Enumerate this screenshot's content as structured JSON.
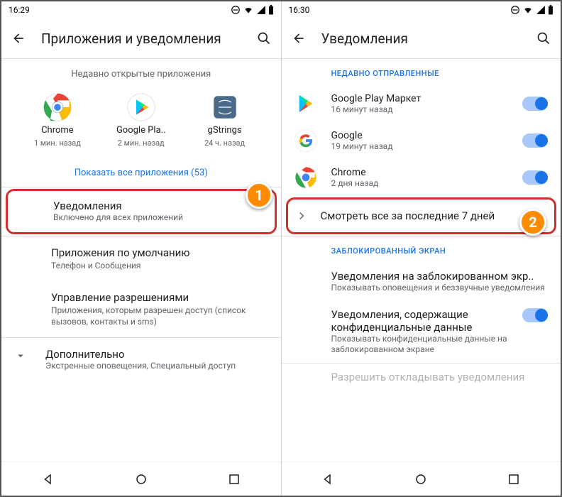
{
  "left": {
    "status_time": "16:29",
    "header_title": "Приложения и уведомления",
    "recent_apps_label": "Недавно открытые приложения",
    "apps": [
      {
        "name": "Chrome",
        "time": "1 мин. назад"
      },
      {
        "name": "Google Pla..",
        "time": "2 мин. назад"
      },
      {
        "name": "gStrings",
        "time": "24 ч. назад"
      }
    ],
    "show_all": "Показать все приложения (53)",
    "notifications": {
      "title": "Уведомления",
      "sub": "Включено для всех приложений"
    },
    "default_apps": {
      "title": "Приложения по умолчанию",
      "sub": "Телефон и Сообщения"
    },
    "permissions": {
      "title": "Управление разрешениями",
      "sub": "Приложения, которым разрешен доступ (список вызовов, контакты и sms)"
    },
    "advanced": {
      "title": "Дополнительно",
      "sub": "Экстренные оповещения, Специальный доступ"
    }
  },
  "right": {
    "status_time": "16:30",
    "header_title": "Уведомления",
    "recent_sent": "НЕДАВНО ОТПРАВЛЕННЫЕ",
    "notif_items": [
      {
        "name": "Google Play Маркет",
        "time": "16 минут назад"
      },
      {
        "name": "Google",
        "time": "19 минут назад"
      },
      {
        "name": "Chrome",
        "time": "2 дня назад"
      }
    ],
    "see_all": "Смотреть все за последние 7 дней",
    "lock_section": "ЗАБЛОКИРОВАННЫЙ ЭКРАН",
    "lock1": {
      "title": "Уведомления на заблокированном экр..",
      "sub": "Показывать оповещения и беззвучные уведомления"
    },
    "lock2": {
      "title": "Уведомления, содержащие конфиденциальные данные",
      "sub": "Показывать конфиденциальные данные на заблокированном экране"
    },
    "lock3": {
      "title": "Разрешить откладывать уведомления"
    }
  },
  "callouts": {
    "c1": "1",
    "c2": "2"
  }
}
